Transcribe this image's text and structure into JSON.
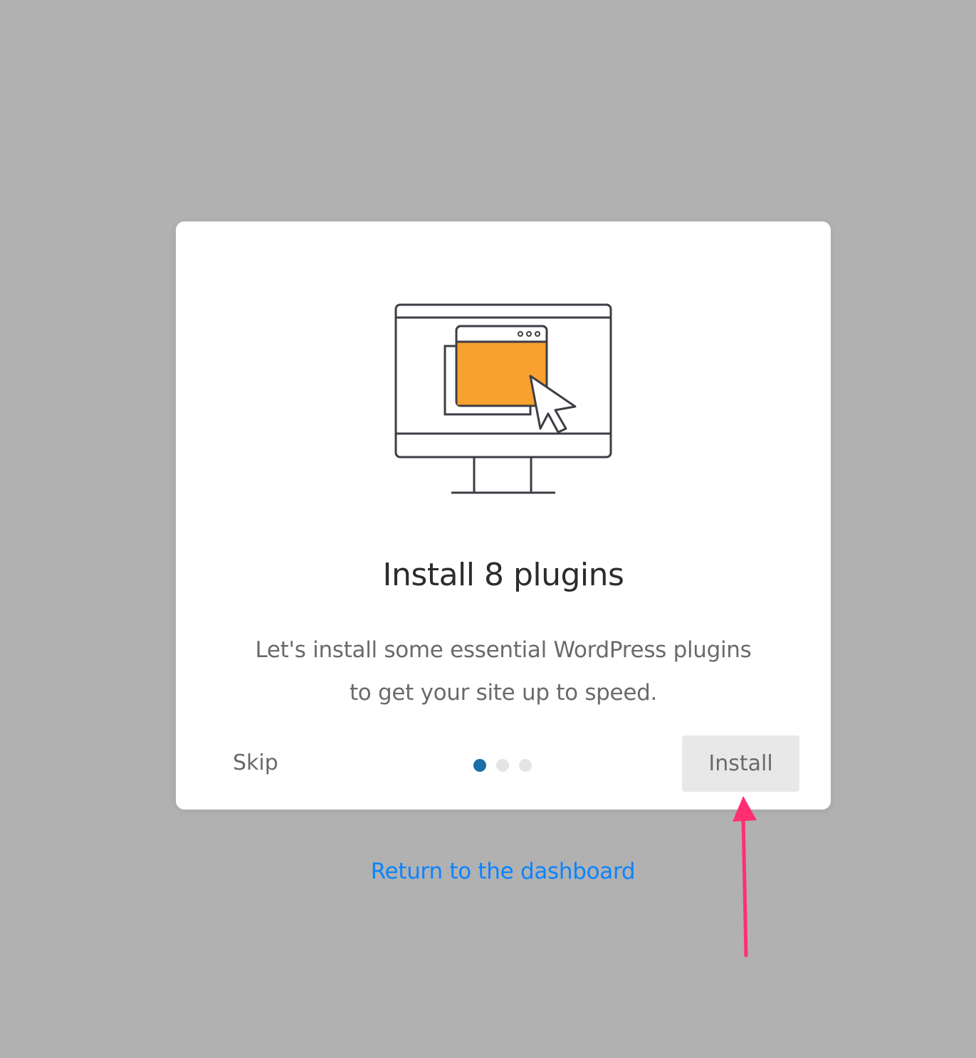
{
  "dialog": {
    "title": "Install 8 plugins",
    "description": "Let's install some essential WordPress plugins to get your site up to speed.",
    "skip_label": "Skip",
    "install_label": "Install",
    "steps": {
      "total": 3,
      "current": 1
    },
    "illustration_icon": "monitor-window-cursor-icon"
  },
  "return_link_label": "Return to the dashboard",
  "colors": {
    "backdrop": "#b1b1b1",
    "card": "#ffffff",
    "accent_orange": "#f9a12e",
    "active_dot": "#1a6fa8",
    "link": "#0a84ff",
    "annotation_arrow": "#ff2f72"
  }
}
